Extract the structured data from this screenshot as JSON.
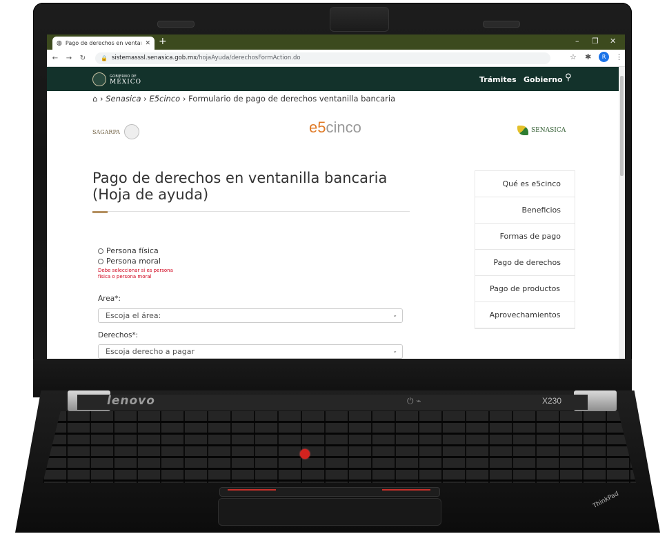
{
  "browser": {
    "tab_title": "Pago de derechos en ventanilla",
    "url_host": "sistemasssl.senasica.gob.mx",
    "url_path": "/hojaAyuda/derechosFormAction.do",
    "avatar_initial": "R"
  },
  "gov_header": {
    "logo_small": "GOBIERNO DE",
    "logo_big": "MÉXICO",
    "nav": [
      "Trámites",
      "Gobierno"
    ]
  },
  "breadcrumb": {
    "senasica": "Senasica",
    "e5cinco": "E5cinco",
    "current": "Formulario de pago de derechos ventanilla bancaria",
    "sep": "›"
  },
  "logos": {
    "sagarpa": "SAGARPA",
    "e5cinco_prefix": "e5",
    "e5cinco_suffix": "cinco",
    "senasica": "SENASICA"
  },
  "page": {
    "title": "Pago de derechos en ventanilla bancaria (Hoja de ayuda)"
  },
  "form": {
    "radio_fisica": "Persona física",
    "radio_moral": "Persona moral",
    "error": "Debe seleccionar si es persona física o persona moral",
    "area_label": "Area*:",
    "area_select": "Escoja el área:",
    "derechos_label": "Derechos*:",
    "derechos_select": "Escoja derecho a pagar"
  },
  "sidebar": {
    "items": [
      "Qué es e5cinco",
      "Beneficios",
      "Formas de pago",
      "Pago de derechos",
      "Pago de productos",
      "Aprovechamientos"
    ]
  },
  "laptop": {
    "brand": "lenovo",
    "model": "X230"
  }
}
